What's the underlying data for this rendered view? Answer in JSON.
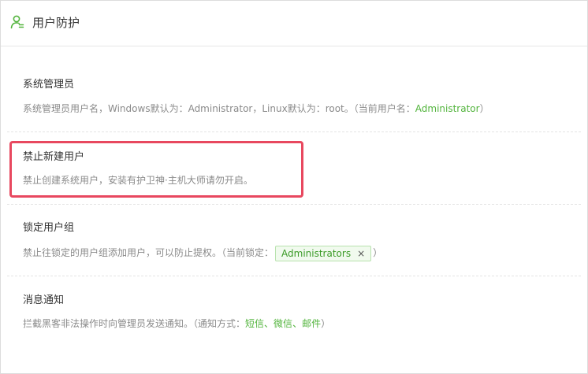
{
  "header": {
    "title": "用户防护",
    "icon": "user-shield-icon"
  },
  "sections": {
    "admin": {
      "title": "系统管理员",
      "desc_prefix": "系统管理员用户名，Windows默认为：Administrator，Linux默认为：root。（当前用户名：",
      "current_user": "Administrator",
      "desc_suffix": "）"
    },
    "no_new_user": {
      "title": "禁止新建用户",
      "desc": "禁止创建系统用户，安装有护卫神·主机大师请勿开启。"
    },
    "lock_group": {
      "title": "锁定用户组",
      "desc_prefix": "禁止往锁定的用户组添加用户，可以防止提权。（当前锁定：",
      "locked_group": "Administrators",
      "remove_label": "×",
      "desc_suffix": "）"
    },
    "notify": {
      "title": "消息通知",
      "desc_prefix": "拦截黑客非法操作时向管理员发送通知。（通知方式：",
      "methods": [
        "短信",
        "微信",
        "邮件"
      ],
      "separator": "、",
      "desc_suffix": "）"
    }
  },
  "colors": {
    "accent_green": "#52b43c",
    "highlight_red": "#e8485f"
  }
}
